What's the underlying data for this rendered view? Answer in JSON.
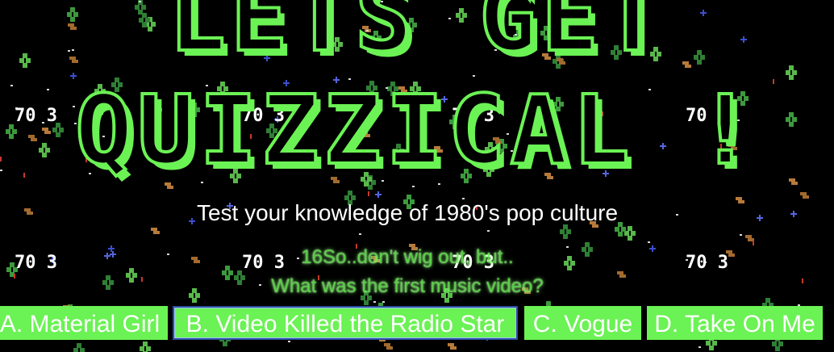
{
  "title": {
    "line1": "LETS GET",
    "line2": "QUIZZICAL !"
  },
  "subtitle": "Test your knowledge of 1980's pop culture",
  "question": {
    "intro": "16So..don't wig out, but..",
    "text": "What was the first music video?"
  },
  "answers": [
    {
      "label": "A. Material Girl"
    },
    {
      "label": "B. Video Killed the Radio Star"
    },
    {
      "label": "C. Vogue"
    },
    {
      "label": "D. Take On Me"
    }
  ],
  "colors": {
    "background": "#000000",
    "accent_green": "#6bf254",
    "text_white": "#ffffff",
    "focus_blue": "#2b4f9e"
  },
  "background_hud_text": "70 3"
}
